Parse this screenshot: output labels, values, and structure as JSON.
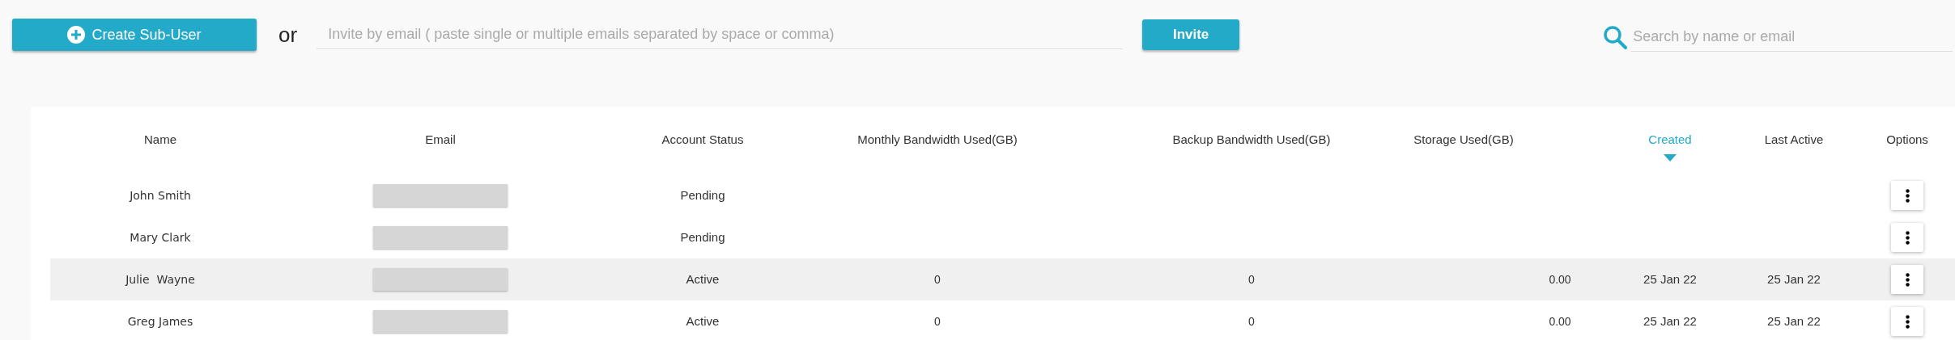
{
  "toolbar": {
    "create_button": "Create Sub-User",
    "separator": "or",
    "invite_field": {
      "placeholder": "Invite by email ( paste single or multiple emails separated by space or comma)"
    },
    "invite_button": "Invite",
    "search": {
      "placeholder": "Search by name or email"
    }
  },
  "table": {
    "columns": [
      {
        "label": "Name",
        "sorted": false
      },
      {
        "label": "Email",
        "sorted": false
      },
      {
        "label": "Account Status",
        "sorted": false
      },
      {
        "label": "Monthly Bandwidth Used(GB)",
        "sorted": false
      },
      {
        "label": "Backup Bandwidth Used(GB)",
        "sorted": false
      },
      {
        "label": "Storage Used(GB)",
        "sorted": false
      },
      {
        "label": "Created",
        "sorted": true
      },
      {
        "label": "Last Active",
        "sorted": false
      },
      {
        "label": "Options",
        "sorted": false
      }
    ],
    "rows": [
      {
        "name": "John Smith",
        "status": "Pending",
        "monthly": "",
        "backup": "",
        "storage": "",
        "created": "",
        "last_active": "",
        "hovered": false
      },
      {
        "name": "Mary Clark",
        "status": "Pending",
        "monthly": "",
        "backup": "",
        "storage": "",
        "created": "",
        "last_active": "",
        "hovered": false
      },
      {
        "name": "Julie  Wayne",
        "status": "Active",
        "monthly": "0",
        "backup": "0",
        "storage": "0.00",
        "created": "25 Jan 22",
        "last_active": "25 Jan 22",
        "hovered": true
      },
      {
        "name": "Greg James",
        "status": "Active",
        "monthly": "0",
        "backup": "0",
        "storage": "0.00",
        "created": "25 Jan 22",
        "last_active": "25 Jan 22",
        "hovered": false
      }
    ]
  }
}
